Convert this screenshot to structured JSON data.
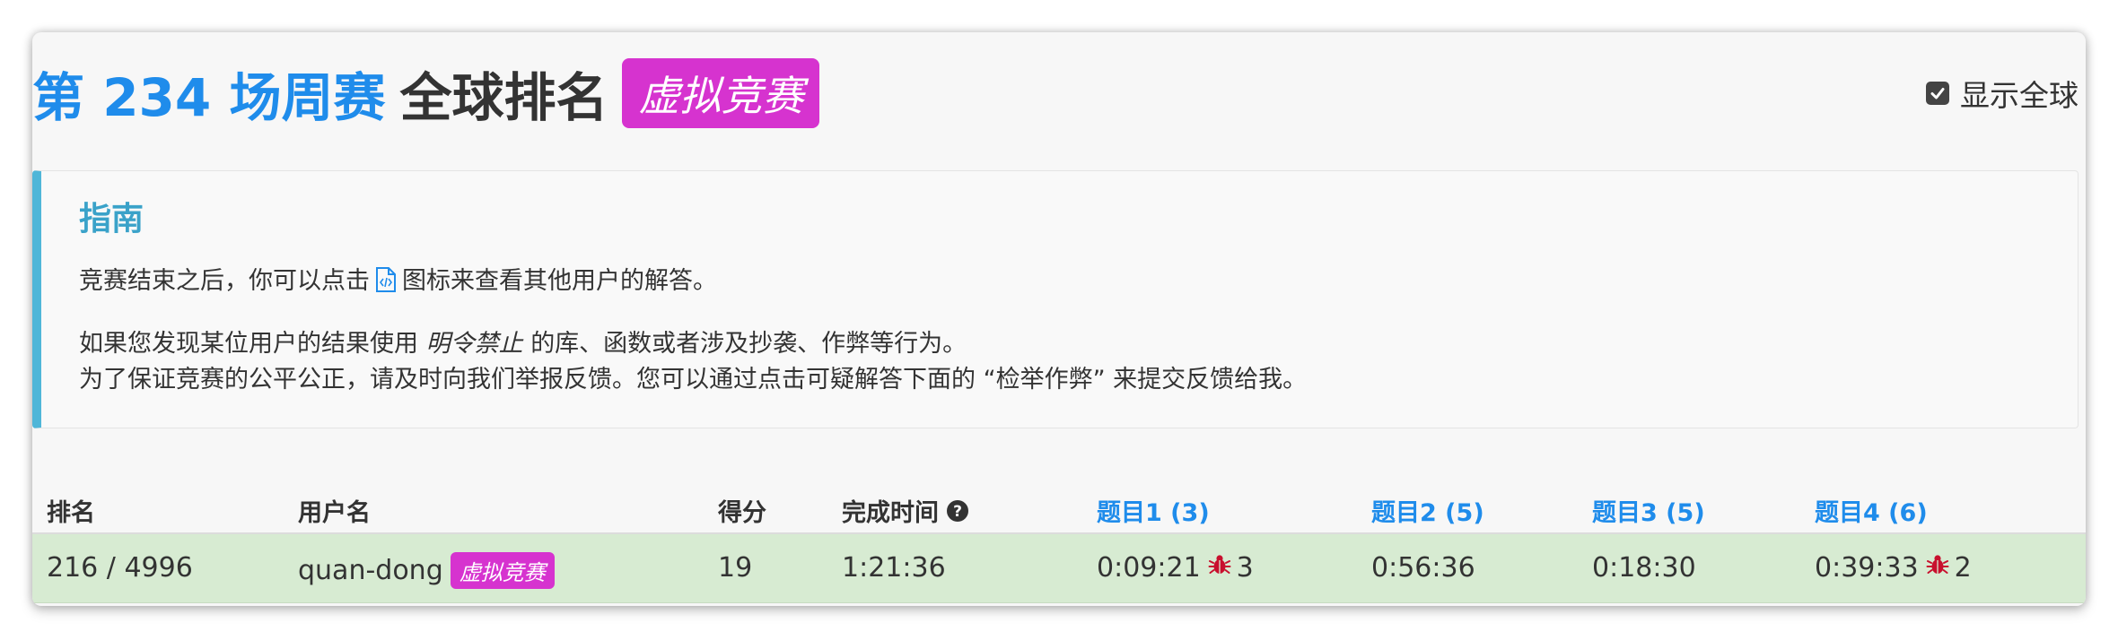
{
  "header": {
    "contest_name": "第 234 场周赛",
    "ranking_title": "全球排名",
    "virtual_badge": "虚拟竞赛",
    "show_global_label": "显示全球",
    "show_global_checked": true
  },
  "guide": {
    "title": "指南",
    "line1_before": "竞赛结束之后，你可以点击",
    "line1_after": "图标来查看其他用户的解答。",
    "line2_before": "如果您发现某位用户的结果使用",
    "line2_forbidden": "明令禁止",
    "line2_after": "的库、函数或者涉及抄袭、作弊等行为。",
    "line3": "为了保证竞赛的公平公正，请及时向我们举报反馈。您可以通过点击可疑解答下面的 “检举作弊” 来提交反馈给我。"
  },
  "table": {
    "headers": {
      "rank": "排名",
      "username": "用户名",
      "score": "得分",
      "finish_time": "完成时间",
      "q1": "题目1 (3)",
      "q2": "题目2 (5)",
      "q3": "题目3 (5)",
      "q4": "题目4 (6)"
    },
    "rows": [
      {
        "rank": "216 / 4996",
        "username": "quan-dong",
        "badge": "虚拟竞赛",
        "score": "19",
        "finish_time": "1:21:36",
        "q1_time": "0:09:21",
        "q1_bugs": "3",
        "q2_time": "0:56:36",
        "q3_time": "0:18:30",
        "q4_time": "0:39:33",
        "q4_bugs": "2"
      }
    ]
  },
  "colors": {
    "accent_blue": "#1f8ceb",
    "badge_magenta": "#d633cf",
    "guide_border": "#4fb6d8",
    "row_highlight": "#d7ebd2",
    "bug_red": "#c8102e"
  },
  "icons": [
    "checkbox-checked-icon",
    "code-file-icon",
    "help-circle-icon",
    "bug-icon"
  ]
}
